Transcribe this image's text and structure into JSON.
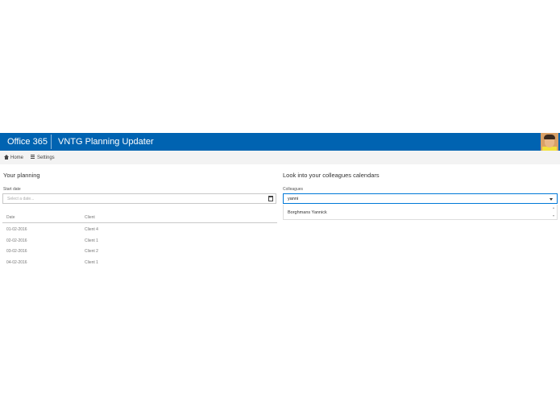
{
  "header": {
    "brand": "Office 365",
    "app_title": "VNTG Planning Updater",
    "avatar_icon": "user-avatar",
    "bar_color": "#0063b1"
  },
  "nav": {
    "home_label": "Home",
    "home_icon": "home-icon",
    "settings_label": "Settings",
    "settings_icon": "list-icon"
  },
  "left": {
    "title": "Your planning",
    "start_label": "Start date",
    "start_placeholder": "Select a date...",
    "calendar_icon": "calendar-icon",
    "table": {
      "headers": [
        "Date",
        "Client"
      ],
      "rows": [
        [
          "01-02-2016",
          "Client 4"
        ],
        [
          "02-02-2016",
          "Client 1"
        ],
        [
          "03-02-2016",
          "Client 2"
        ],
        [
          "04-02-2016",
          "Client 1"
        ]
      ]
    }
  },
  "right": {
    "title": "Look into your colleagues calendars",
    "colleagues_label": "Colleagues",
    "colleagues_value": "yanni",
    "dropdown_icon": "chevron-down-icon",
    "suggestions": [
      "Borghmans Yannick"
    ],
    "accent_color": "#0078d7"
  }
}
